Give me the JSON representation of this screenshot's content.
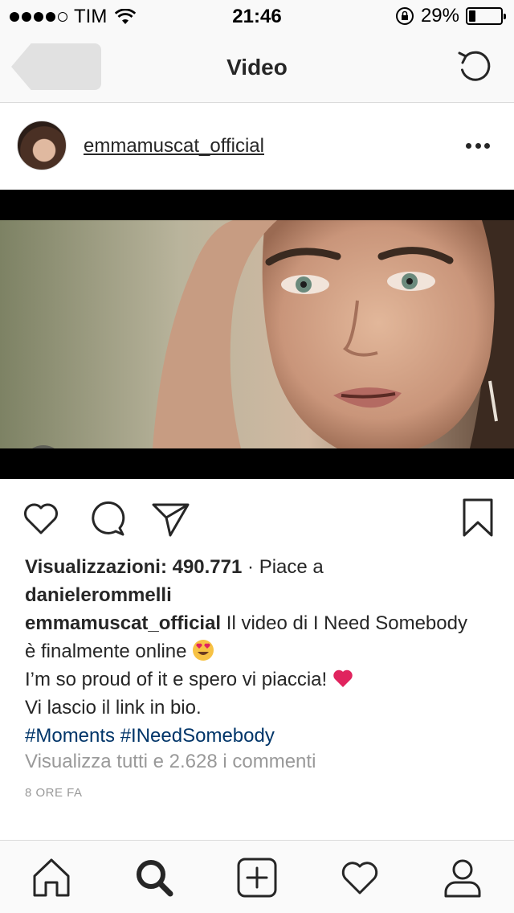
{
  "status_bar": {
    "carrier": "TIM",
    "time": "21:46",
    "battery_percent": "29%",
    "battery_level": 0.29
  },
  "nav": {
    "title": "Video"
  },
  "post": {
    "username": "emmamuscat_official",
    "views_label": "Visualizzazioni: 490.771",
    "likes_prefix": " · Piace a",
    "liked_by": "danielerommelli",
    "caption_user": "emmamuscat_official",
    "caption_line1": " Il video di I Need Somebody",
    "caption_line2": "è finalmente online",
    "caption_line3": "I’m so proud of it e spero vi piaccia!",
    "caption_line4": "Vi lascio il link in bio.",
    "hashtags": "#Moments #INeedSomebody",
    "view_comments": "Visualizza tutti e 2.628 i commenti",
    "time_ago": "8 ORE FA"
  },
  "colors": {
    "hashtag": "#003569",
    "muted_text": "#999999",
    "emoji_heart": "#e0245e"
  },
  "icons": {
    "back": "back-icon",
    "refresh": "refresh-icon",
    "more": "more-icon",
    "mute": "muted-speaker-icon",
    "like": "heart-icon",
    "comment": "comment-icon",
    "share": "send-icon",
    "save": "bookmark-icon",
    "home": "home-icon",
    "search": "search-icon",
    "add": "add-post-icon",
    "activity": "heart-icon",
    "profile": "profile-icon"
  }
}
